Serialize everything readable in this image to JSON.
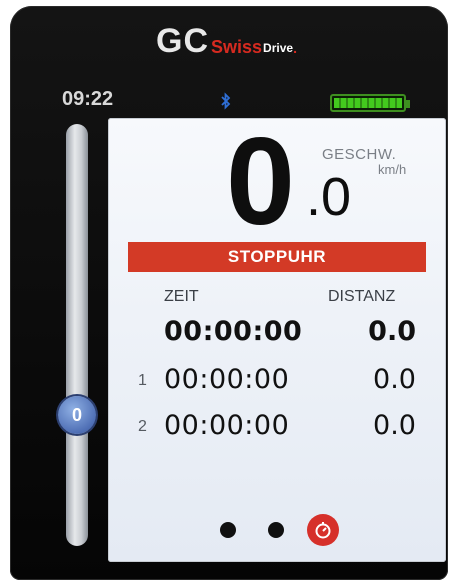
{
  "brand": {
    "gc": "GC",
    "swiss": "Swiss",
    "drive": "Drive",
    "dot": "."
  },
  "status": {
    "time": "09:22",
    "bluetooth_icon": "bluetooth-icon",
    "battery_level": 1.0,
    "battery_color": "#43c91e"
  },
  "assist_slider": {
    "value": "0",
    "level": 0.0
  },
  "speed": {
    "label": "GESCHW.",
    "unit": "km/h",
    "integer": "0",
    "decimal": ".0"
  },
  "mode": {
    "title": "STOPPUHR",
    "color": "#d33a26"
  },
  "table": {
    "col_time": "ZEIT",
    "col_distance": "DISTANZ",
    "rows": [
      {
        "index": "",
        "time": "00:00:00",
        "distance": "0.0"
      },
      {
        "index": "1",
        "time": "00:00:00",
        "distance": "0.0"
      },
      {
        "index": "2",
        "time": "00:00:00",
        "distance": "0.0"
      }
    ]
  },
  "pager": {
    "pages": 3,
    "active": 3,
    "active_icon": "stopwatch-icon"
  }
}
